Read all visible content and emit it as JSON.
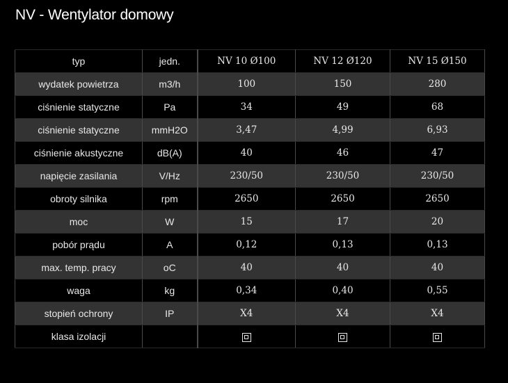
{
  "title": "NV - Wentylator domowy",
  "table": {
    "header": {
      "param": "typ",
      "unit": "jedn.",
      "models": [
        "NV 10 Ø100",
        "NV 12 Ø120",
        "NV 15 Ø150"
      ]
    },
    "rows": [
      {
        "param": "wydatek powietrza",
        "unit": "m3/h",
        "values": [
          "100",
          "150",
          "280"
        ]
      },
      {
        "param": "ciśnienie statyczne",
        "unit": "Pa",
        "values": [
          "34",
          "49",
          "68"
        ]
      },
      {
        "param": "ciśnienie statyczne",
        "unit": "mmH2O",
        "values": [
          "3,47",
          "4,99",
          "6,93"
        ]
      },
      {
        "param": "ciśnienie akustyczne",
        "unit": "dB(A)",
        "values": [
          "40",
          "46",
          "47"
        ]
      },
      {
        "param": "napięcie zasilania",
        "unit": "V/Hz",
        "values": [
          "230/50",
          "230/50",
          "230/50"
        ]
      },
      {
        "param": "obroty silnika",
        "unit": "rpm",
        "values": [
          "2650",
          "2650",
          "2650"
        ]
      },
      {
        "param": "moc",
        "unit": "W",
        "values": [
          "15",
          "17",
          "20"
        ]
      },
      {
        "param": "pobór prądu",
        "unit": "A",
        "values": [
          "0,12",
          "0,13",
          "0,13"
        ]
      },
      {
        "param": "max. temp. pracy",
        "unit": "oC",
        "values": [
          "40",
          "40",
          "40"
        ]
      },
      {
        "param": "waga",
        "unit": "kg",
        "values": [
          "0,34",
          "0,40",
          "0,55"
        ]
      },
      {
        "param": "stopień ochrony",
        "unit": "IP",
        "values": [
          "X4",
          "X4",
          "X4"
        ]
      }
    ],
    "insulation_row": {
      "param": "klasa izolacji",
      "unit": "",
      "icons": [
        "double-insulation-icon",
        "double-insulation-icon",
        "double-insulation-icon"
      ]
    }
  },
  "colors": {
    "background": "#000000",
    "row_alt": "#333333",
    "border": "#4a4a4a",
    "text": "#e8e8e8"
  }
}
